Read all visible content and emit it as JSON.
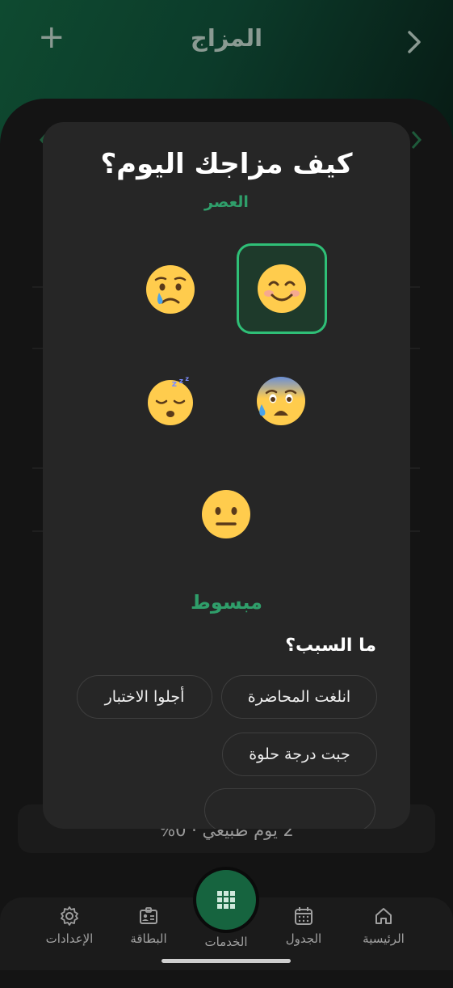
{
  "header": {
    "title": "المزاج",
    "add_icon": "plus-icon",
    "back_icon": "chevron-right-icon"
  },
  "background": {
    "stat_text": "2 يوم طبيعي · 0%"
  },
  "modal": {
    "question": "كيف مزاجك اليوم؟",
    "period": "العصر",
    "moods": [
      {
        "emoji": "smiling-face",
        "selected": true
      },
      {
        "emoji": "crying-face",
        "selected": false
      },
      {
        "emoji": "anxious-sweat-face",
        "selected": false
      },
      {
        "emoji": "sleepy-face",
        "selected": false
      },
      {
        "emoji": "neutral-face",
        "selected": false
      }
    ],
    "selected_label": "مبسوط",
    "reason_question": "ما السبب؟",
    "reasons": [
      "انلغت المحاضرة",
      "أجلوا الاختبار",
      "جبت درجة حلوة"
    ]
  },
  "nav": {
    "items": [
      {
        "label": "الرئيسية",
        "icon": "home-icon"
      },
      {
        "label": "الجدول",
        "icon": "calendar-icon"
      },
      {
        "label": "الخدمات",
        "icon": "grid-icon"
      },
      {
        "label": "البطاقة",
        "icon": "id-card-icon"
      },
      {
        "label": "الإعدادات",
        "icon": "gear-icon"
      }
    ]
  },
  "colors": {
    "accent": "#2fbf77",
    "accent_dark": "#16643f",
    "modal_bg": "#262626"
  }
}
